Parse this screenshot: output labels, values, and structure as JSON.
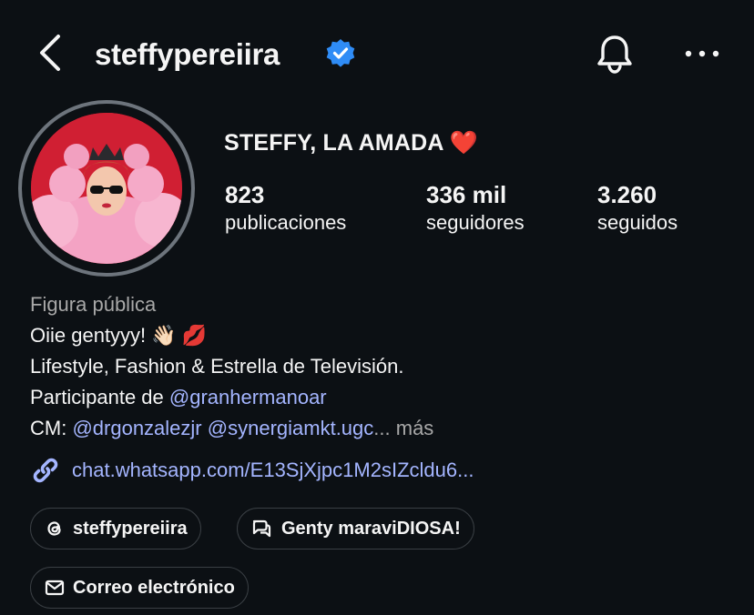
{
  "header": {
    "username": "steffypereiira",
    "back_icon": "chevron-left-icon",
    "verified_icon": "verified-badge-icon",
    "notify_icon": "bell-icon",
    "more_icon": "more-dots-icon"
  },
  "profile": {
    "display_name": "STEFFY, LA AMADA",
    "display_name_emoji": "❤️",
    "stats": [
      {
        "value": "823",
        "label": "publicaciones"
      },
      {
        "value": "336 mil",
        "label": "seguidores"
      },
      {
        "value": "3.260",
        "label": "seguidos"
      }
    ]
  },
  "bio": {
    "category": "Figura pública",
    "line1_text": "Oiie gentyyy!",
    "line1_emojis": "👋🏻 💋",
    "line2": "Lifestyle, Fashion & Estrella de Televisión.",
    "line3_prefix": "Participante de ",
    "line3_mention": "@granhermanoar",
    "line4_prefix": "CM: ",
    "line4_mention1": "@drgonzalezjr",
    "line4_mention2": "@synergiamkt.ugc",
    "line4_ellipsis": "...",
    "line4_more": "más",
    "link_icon": "link-icon",
    "link_text": "chat.whatsapp.com/E13SjXjpc1M2sIZcldu6..."
  },
  "pills": [
    {
      "label": "steffypereiira",
      "icon": "threads-icon"
    },
    {
      "label": "Genty maraviDIOSA!",
      "icon": "chat-bubbles-icon"
    },
    {
      "label": "Correo electrónico",
      "icon": "mail-icon"
    }
  ],
  "colors": {
    "background": "#0c1014",
    "link": "#a4b5ff",
    "muted": "#a8a8a8",
    "verified": "#2f8cf6"
  }
}
